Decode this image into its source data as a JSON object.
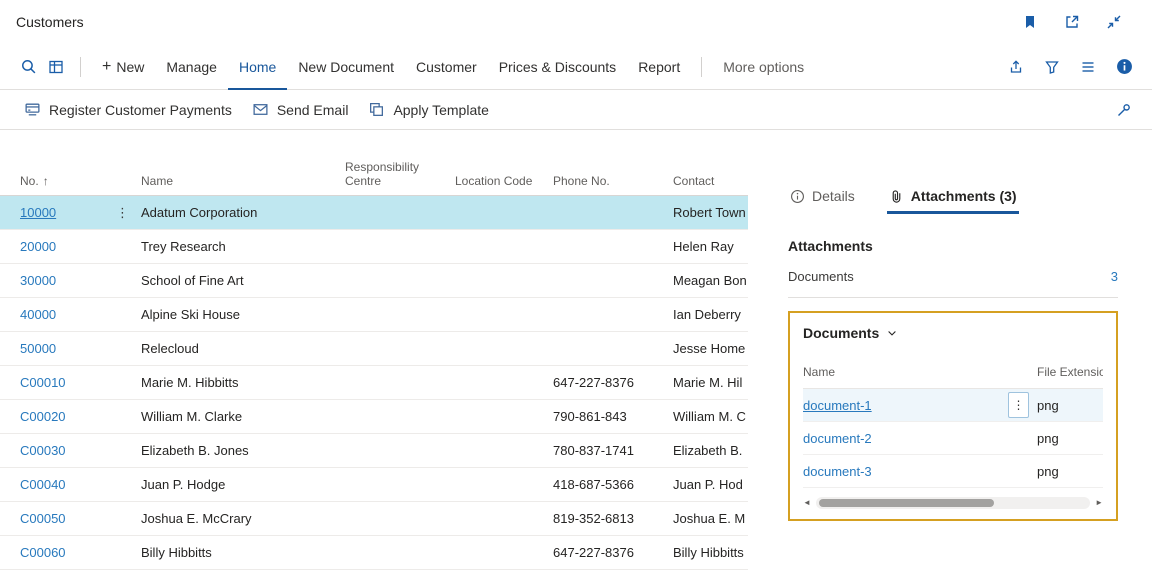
{
  "colors": {
    "accent_blue": "#19579b",
    "link_blue": "#2879bd",
    "selected_row": "#bfe7f0",
    "highlight_border": "#d5a021"
  },
  "icons": {
    "plus": "+",
    "ellipsis": "⋮",
    "sort_asc": "↑",
    "scroll_left": "◄",
    "scroll_right": "►"
  },
  "titlebar": {
    "title": "Customers"
  },
  "ribbon": {
    "menu": [
      {
        "label": "New"
      },
      {
        "label": "Manage"
      },
      {
        "label": "Home"
      },
      {
        "label": "New Document"
      },
      {
        "label": "Customer"
      },
      {
        "label": "Prices & Discounts"
      },
      {
        "label": "Report"
      }
    ],
    "more_options": "More options"
  },
  "actionbar": {
    "register": "Register Customer Payments",
    "send_email": "Send Email",
    "apply_template": "Apply Template"
  },
  "grid": {
    "headers": {
      "no": "No.",
      "name": "Name",
      "responsibility_centre": "Responsibility Centre",
      "location_code": "Location Code",
      "phone": "Phone No.",
      "contact": "Contact"
    },
    "rows": [
      {
        "no": "10000",
        "name": "Adatum Corporation",
        "phone": "",
        "contact": "Robert Town"
      },
      {
        "no": "20000",
        "name": "Trey Research",
        "phone": "",
        "contact": "Helen Ray"
      },
      {
        "no": "30000",
        "name": "School of Fine Art",
        "phone": "",
        "contact": "Meagan Bon"
      },
      {
        "no": "40000",
        "name": "Alpine Ski House",
        "phone": "",
        "contact": "Ian Deberry"
      },
      {
        "no": "50000",
        "name": "Relecloud",
        "phone": "",
        "contact": "Jesse Home"
      },
      {
        "no": "C00010",
        "name": "Marie M. Hibbitts",
        "phone": "647-227-8376",
        "contact": "Marie M. Hil"
      },
      {
        "no": "C00020",
        "name": "William M. Clarke",
        "phone": "790-861-843",
        "contact": "William M. C"
      },
      {
        "no": "C00030",
        "name": "Elizabeth B. Jones",
        "phone": "780-837-1741",
        "contact": "Elizabeth B."
      },
      {
        "no": "C00040",
        "name": "Juan P. Hodge",
        "phone": "418-687-5366",
        "contact": "Juan P. Hod"
      },
      {
        "no": "C00050",
        "name": "Joshua E. McCrary",
        "phone": "819-352-6813",
        "contact": "Joshua E. M"
      },
      {
        "no": "C00060",
        "name": "Billy Hibbitts",
        "phone": "647-227-8376",
        "contact": "Billy Hibbitts"
      }
    ]
  },
  "factbox": {
    "tabs": {
      "details": "Details",
      "attachments": "Attachments (3)"
    },
    "heading": "Attachments",
    "fact_label": "Documents",
    "fact_value": "3",
    "documents": {
      "title": "Documents",
      "columns": {
        "name": "Name",
        "extension": "File Extension"
      },
      "rows": [
        {
          "name": "document-1",
          "extension": "png"
        },
        {
          "name": "document-2",
          "extension": "png"
        },
        {
          "name": "document-3",
          "extension": "png"
        }
      ]
    }
  }
}
